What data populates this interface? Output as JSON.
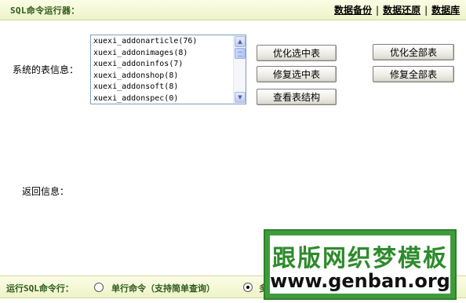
{
  "header": {
    "title": "SQL命令运行器：",
    "links": [
      "数据备份",
      "数据还原",
      "数据库"
    ],
    "separator": "|"
  },
  "tables_section": {
    "label": "系统的表信息：",
    "items": [
      "xuexi_addonarticle(76)",
      "xuexi_addonimages(8)",
      "xuexi_addoninfos(7)",
      "xuexi_addonshop(8)",
      "xuexi_addonsoft(8)",
      "xuexi_addonspec(0)"
    ]
  },
  "buttons": {
    "optimize_selected": "优化选中表",
    "repair_selected": "修复选中表",
    "view_structure": "查看表结构",
    "optimize_all": "优化全部表",
    "repair_all": "修复全部表"
  },
  "return_section": {
    "label": "返回信息："
  },
  "run_section": {
    "label": "运行SQL命令行：",
    "single_option": "单行命令（支持简单查询）",
    "multi_option": "多",
    "selected": "multi"
  },
  "watermark": {
    "title": "跟版网织梦模板",
    "url": "www.genban.org"
  },
  "colors": {
    "header_bg": "#f2f6d4",
    "header_text": "#2d5a1b",
    "watermark_green": "#3f9c3c"
  }
}
